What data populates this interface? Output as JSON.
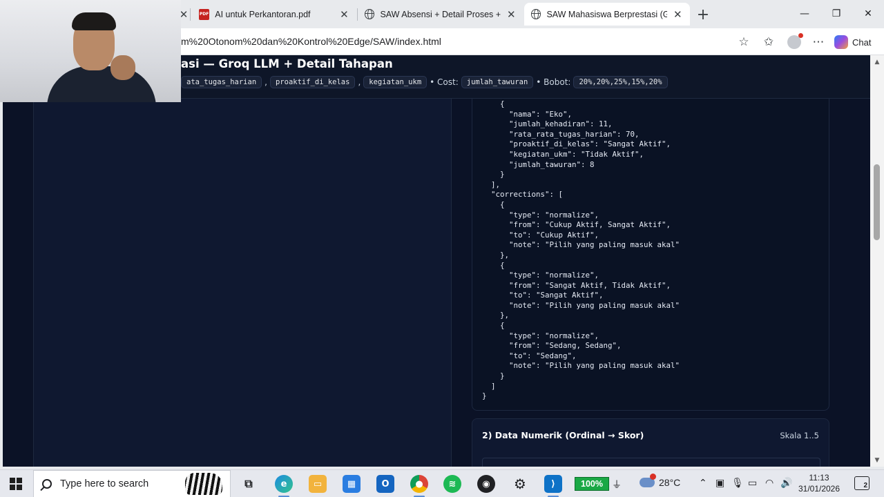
{
  "browser": {
    "tabs": [
      {
        "label": "AI untuk Perkantoran.pdf",
        "icon": "pdf-icon",
        "active": false
      },
      {
        "label": "SAW Absensi + Detail Proses + Gr",
        "icon": "globe-icon",
        "active": false
      },
      {
        "label": "SAW Mahasiswa Berprestasi (Groq",
        "icon": "globe-icon",
        "active": true
      }
    ],
    "url": "m%20Otonom%20dan%20Kontrol%20Edge/SAW/index.html",
    "chat_label": "Chat"
  },
  "page": {
    "title": "asi — Groq LLM + Detail Tahapan",
    "meta": {
      "benefit_chips": [
        "ata_tugas_harian",
        "proaktif_di_kelas",
        "kegiatan_ukm"
      ],
      "cost_label": "• Cost:",
      "cost_chips": [
        "jumlah_tawuran"
      ],
      "weight_label": "• Bobot:",
      "weight_value": "20%,20%,25%,15%,20%"
    },
    "json_output": "    {\n      \"nama\": \"Eko\",\n      \"jumlah_kehadiran\": 11,\n      \"rata_rata_tugas_harian\": 70,\n      \"proaktif_di_kelas\": \"Sangat Aktif\",\n      \"kegiatan_ukm\": \"Tidak Aktif\",\n      \"jumlah_tawuran\": 8\n    }\n  ],\n  \"corrections\": [\n    {\n      \"type\": \"normalize\",\n      \"from\": \"Cukup Aktif, Sangat Aktif\",\n      \"to\": \"Cukup Aktif\",\n      \"note\": \"Pilih yang paling masuk akal\"\n    },\n    {\n      \"type\": \"normalize\",\n      \"from\": \"Sangat Aktif, Tidak Aktif\",\n      \"to\": \"Sangat Aktif\",\n      \"note\": \"Pilih yang paling masuk akal\"\n    },\n    {\n      \"type\": \"normalize\",\n      \"from\": \"Sedang, Sedang\",\n      \"to\": \"Sedang\",\n      \"note\": \"Pilih yang paling masuk akal\"\n    }\n  ]\n}",
    "section2": {
      "title": "2) Data Numerik (Ordinal → Skor)",
      "scale": "Skala 1..5"
    }
  },
  "taskbar": {
    "search_placeholder": "Type here to search",
    "battery": "100%",
    "weather": "28°C",
    "time": "11:13",
    "date": "31/01/2026",
    "notification_count": "2"
  },
  "colors": {
    "page_background": "#0b1226",
    "card_background": "#0a1224",
    "chip_background": "#1a2337",
    "battery_green": "#1aa845"
  }
}
